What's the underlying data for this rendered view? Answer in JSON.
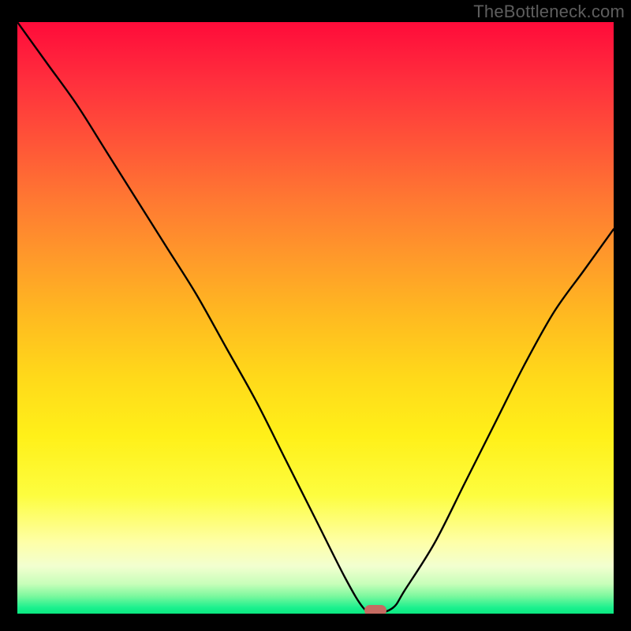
{
  "watermark": "TheBottleneck.com",
  "chart_data": {
    "type": "line",
    "title": "",
    "xlabel": "",
    "ylabel": "",
    "xlim": [
      0,
      100
    ],
    "ylim": [
      0,
      100
    ],
    "grid": false,
    "series": [
      {
        "name": "bottleneck-curve",
        "x": [
          0,
          5,
          10,
          15,
          20,
          25,
          30,
          35,
          40,
          45,
          50,
          55,
          58,
          60,
          63,
          65,
          70,
          75,
          80,
          85,
          90,
          95,
          100
        ],
        "values": [
          100,
          93,
          86,
          78,
          70,
          62,
          54,
          45,
          36,
          26,
          16,
          6,
          1,
          0,
          1,
          4,
          12,
          22,
          32,
          42,
          51,
          58,
          65
        ]
      }
    ],
    "annotations": [
      {
        "name": "min-marker",
        "x": 60,
        "y": 0,
        "shape": "pill",
        "color": "#c66b62"
      }
    ],
    "background_gradient": {
      "orientation": "vertical",
      "stops": [
        {
          "pos": 0,
          "color": "#ff0b3a"
        },
        {
          "pos": 50,
          "color": "#ffbb20"
        },
        {
          "pos": 80,
          "color": "#fdfd3f"
        },
        {
          "pos": 100,
          "color": "#0ae980"
        }
      ]
    }
  }
}
